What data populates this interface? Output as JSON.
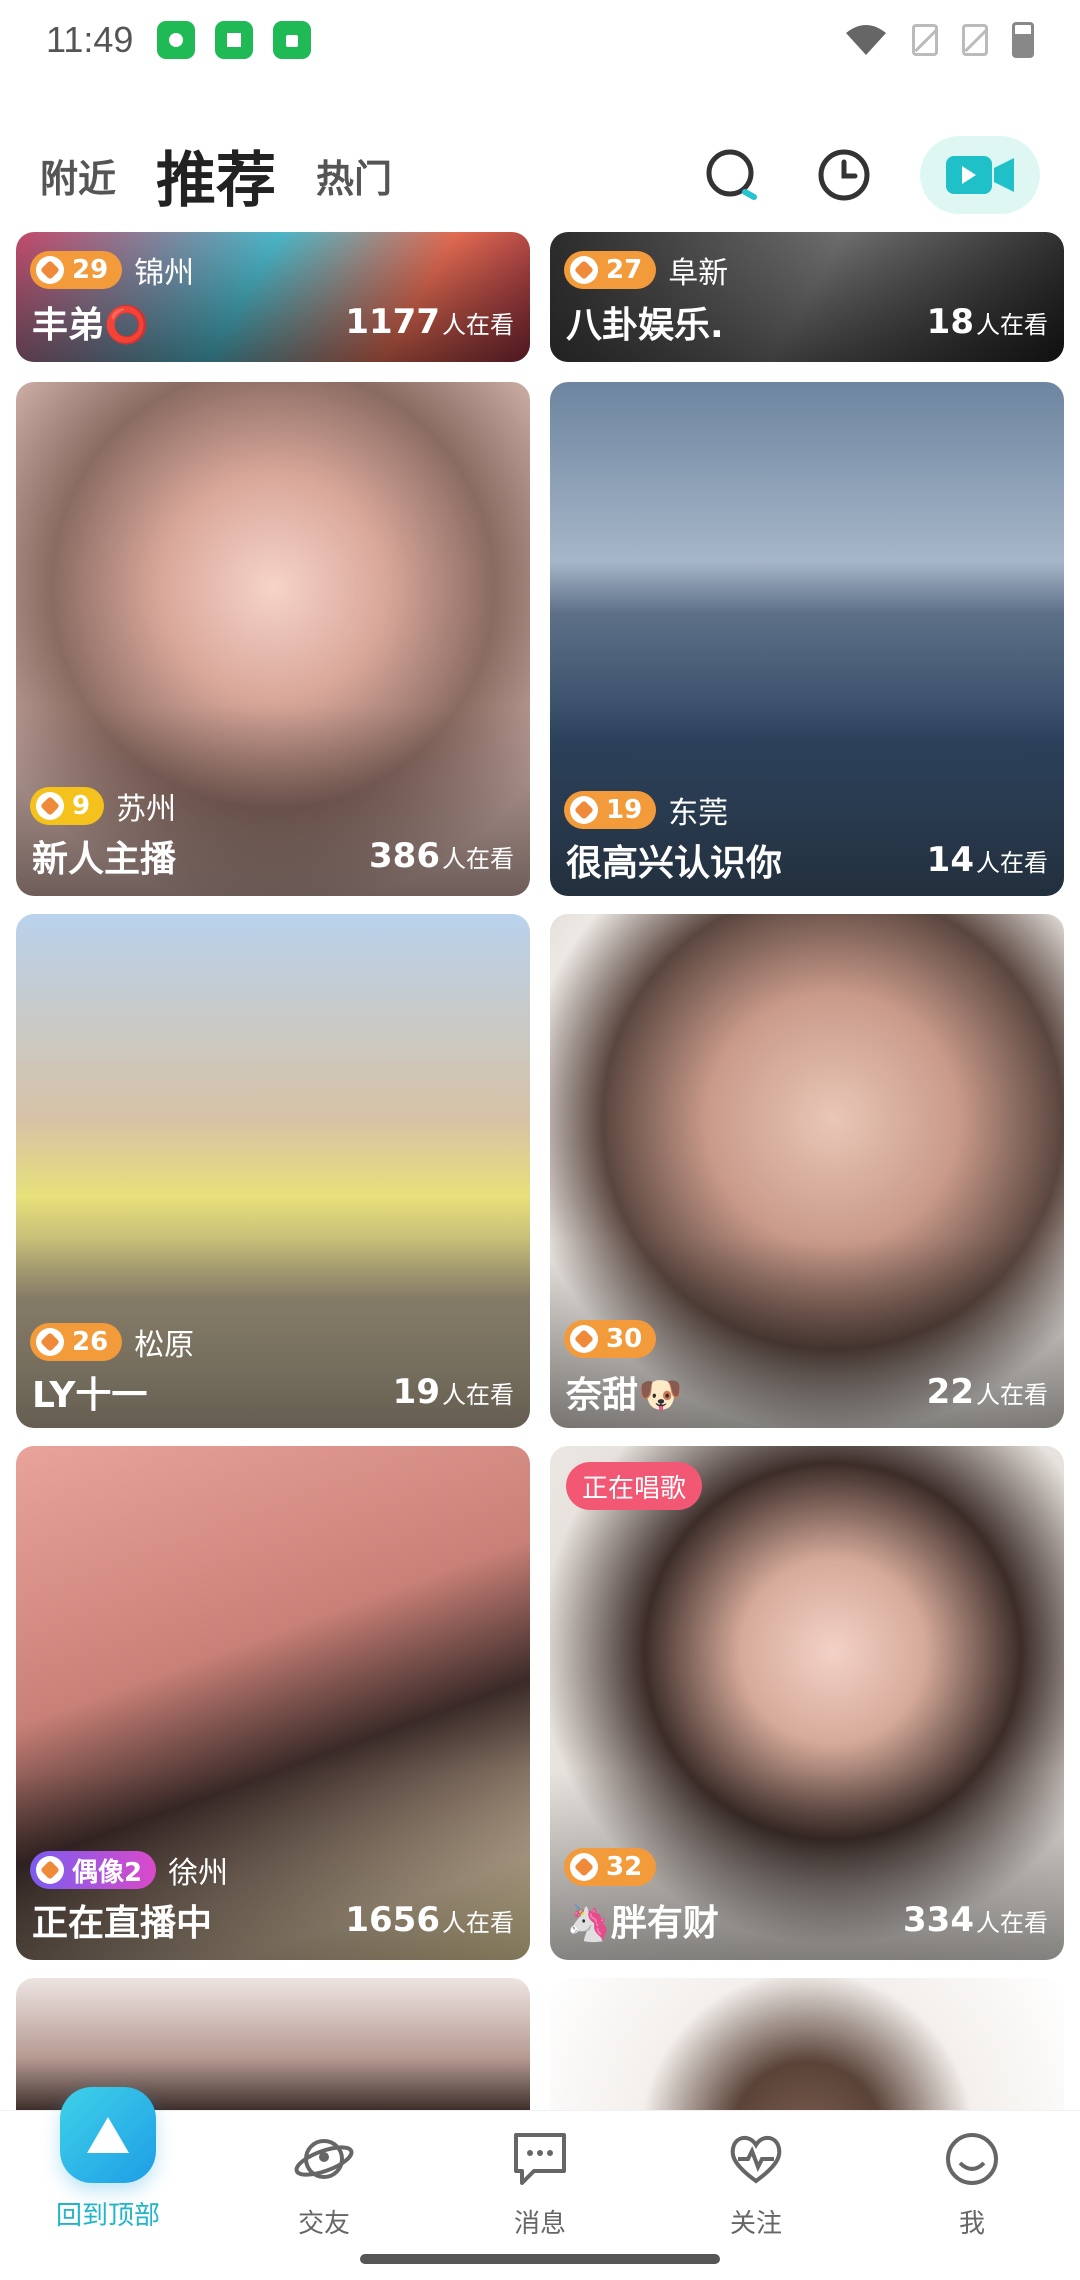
{
  "status": {
    "time": "11:49"
  },
  "header": {
    "tabs": [
      {
        "label": "附近"
      },
      {
        "label": "推荐"
      },
      {
        "label": "热门"
      }
    ],
    "accent": "#23c3cf"
  },
  "cards": [
    {
      "level": "29",
      "city": "锦州",
      "title": "丰弟⭕",
      "viewers": "1177",
      "viewers_suffix": "人在看"
    },
    {
      "level": "27",
      "city": "阜新",
      "title": "八卦娱乐.",
      "viewers": "18",
      "viewers_suffix": "人在看"
    },
    {
      "level": "9",
      "city": "苏州",
      "title": "新人主播",
      "viewers": "386",
      "viewers_suffix": "人在看"
    },
    {
      "level": "19",
      "city": "东莞",
      "title": "很高兴认识你",
      "viewers": "14",
      "viewers_suffix": "人在看"
    },
    {
      "level": "26",
      "city": "松原",
      "title": "LY十一",
      "viewers": "19",
      "viewers_suffix": "人在看"
    },
    {
      "level": "30",
      "city": "",
      "title": "奈甜🐶",
      "viewers": "22",
      "viewers_suffix": "人在看"
    },
    {
      "level": "偶像2",
      "city": "徐州",
      "title": "正在直播中",
      "viewers": "1656",
      "viewers_suffix": "人在看"
    },
    {
      "level": "32",
      "city": "",
      "title": "🦄胖有财",
      "viewers": "334",
      "viewers_suffix": "人在看",
      "tag": "正在唱歌"
    }
  ],
  "bottom_nav": [
    {
      "label": "回到顶部",
      "icon": "up-arrow-icon"
    },
    {
      "label": "交友",
      "icon": "planet-icon"
    },
    {
      "label": "消息",
      "icon": "chat-icon"
    },
    {
      "label": "关注",
      "icon": "heart-pulse-icon"
    },
    {
      "label": "我",
      "icon": "smile-icon"
    }
  ]
}
